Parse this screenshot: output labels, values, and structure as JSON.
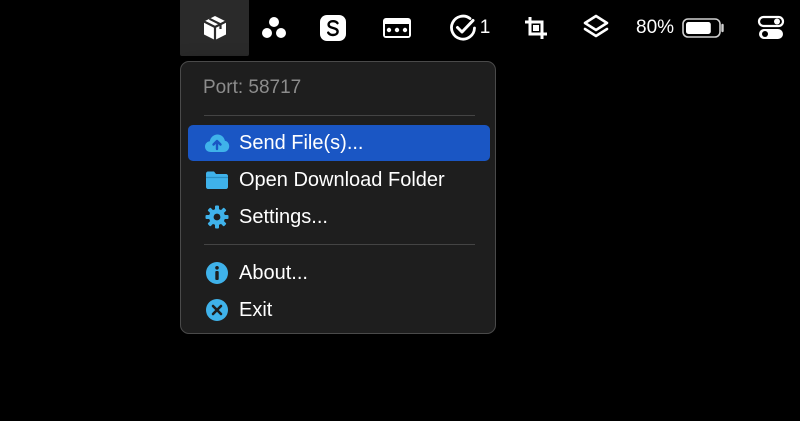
{
  "menubar": {
    "todo_count": "1",
    "battery_percent": "80%",
    "battery_level": 0.8,
    "icons": [
      "app-box-icon",
      "dots-cluster-icon",
      "s-app-icon",
      "window-dots-icon",
      "check-badge-icon",
      "crop-icon",
      "layers-icon",
      "battery-icon",
      "toggles-icon"
    ]
  },
  "menu": {
    "header": "Port: 58717",
    "items": [
      {
        "label": "Send File(s)...",
        "icon": "cloud-upload-icon"
      },
      {
        "label": "Open Download Folder",
        "icon": "folder-icon"
      },
      {
        "label": "Settings...",
        "icon": "gear-icon"
      },
      {
        "label": "About...",
        "icon": "info-icon"
      },
      {
        "label": "Exit",
        "icon": "close-circle-icon"
      }
    ]
  },
  "colors": {
    "accent": "#1a56c4",
    "icon_blue": "#3fb2ea",
    "menu_bg": "#1e1e1e",
    "header_text": "#8c8c8c"
  }
}
